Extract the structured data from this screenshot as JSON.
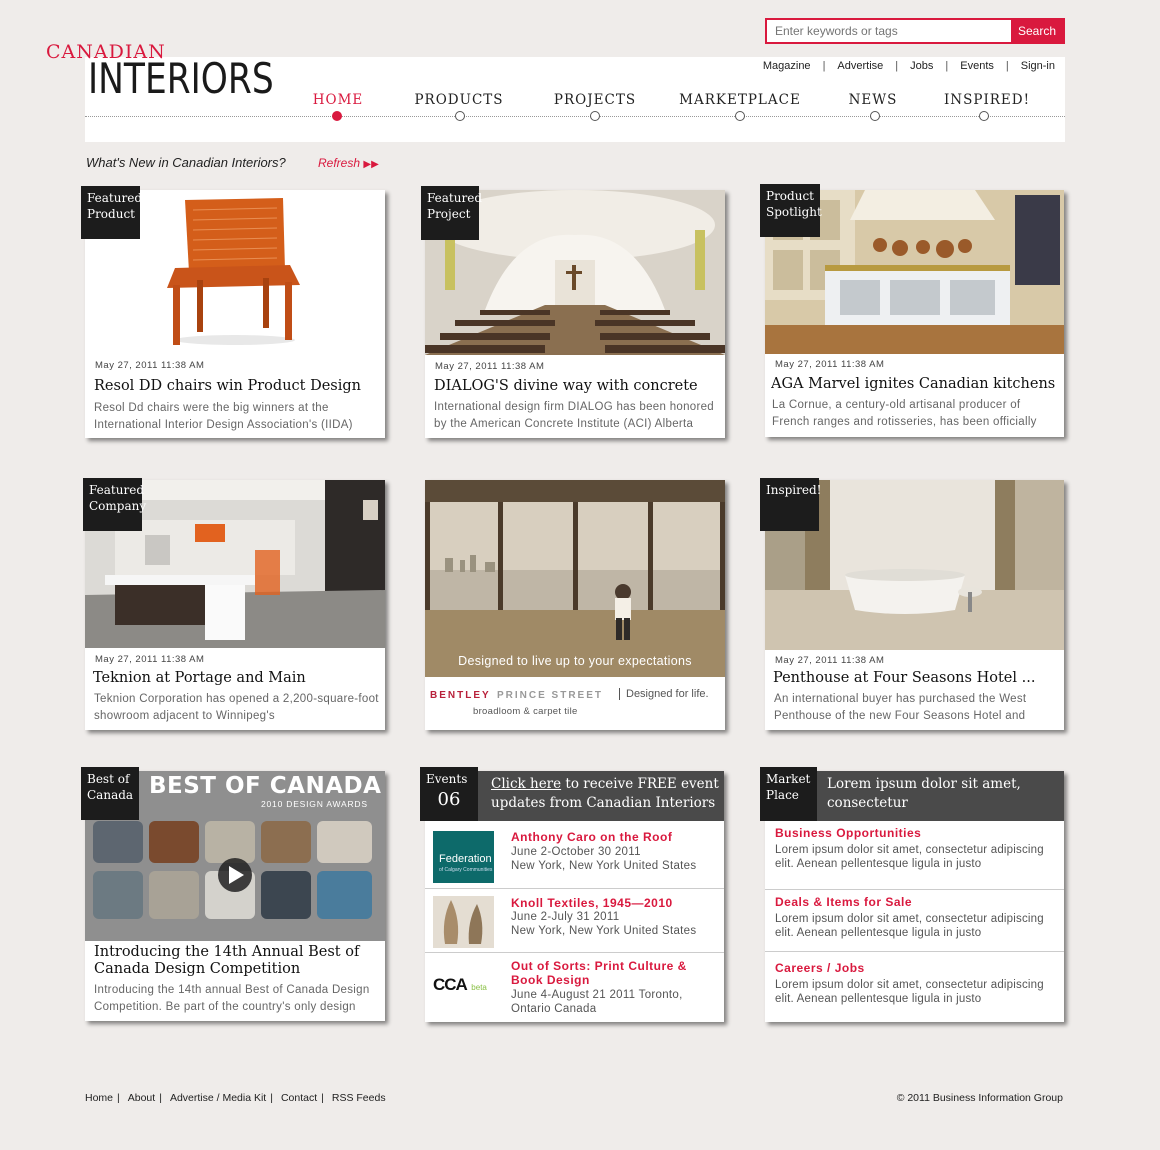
{
  "search": {
    "placeholder": "Enter keywords or tags",
    "button": "Search"
  },
  "logo": {
    "top": "CANADIAN",
    "main": "INTERIORS"
  },
  "util_nav": [
    "Magazine",
    "Advertise",
    "Jobs",
    "Events",
    "Sign-in"
  ],
  "main_nav": [
    "HOME",
    "PRODUCTS",
    "PROJECTS",
    "MARKETPLACE",
    "NEWS",
    "INSPIRED!"
  ],
  "whats_new": {
    "label": "What's New in Canadian Interiors?",
    "refresh": "Refresh"
  },
  "cards": [
    {
      "badge": "Featured Product",
      "date": "May 27, 2011 11:38 AM",
      "title": "Resol DD chairs win Product Design",
      "desc": "Resol Dd chairs were the big winners at the International Interior Design Association's (IIDA)"
    },
    {
      "badge": "Featured Project",
      "date": "May 27, 2011 11:38 AM",
      "title": "DIALOG'S divine way with concrete",
      "desc": "International design firm DIALOG has been honored by the American Concrete Institute (ACI) Alberta"
    },
    {
      "badge": "Product Spotlight",
      "date": "May 27, 2011 11:38 AM",
      "title": "AGA Marvel ignites Canadian kitchens",
      "desc": "La Cornue, a century-old artisanal producer of French ranges and rotisseries, has been officially"
    },
    {
      "badge": "Featured Company",
      "date": "May 27, 2011 11:38 AM",
      "title": "Teknion at Portage and Main",
      "desc": "Teknion Corporation has opened a 2,200-square-foot showroom adjacent to Winnipeg's"
    },
    {
      "badge": "Inspired!",
      "date": "May 27, 2011 11:38 AM",
      "title": "Penthouse at Four Seasons Hotel ...",
      "desc": "An international buyer has purchased the West Penthouse of the new Four Seasons Hotel and"
    },
    {
      "badge": "Best of Canada",
      "title": "Introducing the 14th Annual Best of Canada Design Competition",
      "desc": "Introducing the 14th annual Best of Canada Design Competition. Be part of the country's only design"
    }
  ],
  "ad": {
    "tagline": "Designed to live up to your expectations",
    "brand1": "BENTLEY",
    "brand2": "PRINCE STREET",
    "slogan": "Designed for life.",
    "sub": "broadloom & carpet tile"
  },
  "best_of_canada": {
    "header1": "BEST OF CANADA",
    "header2": "2010 DESIGN AWARDS"
  },
  "events": {
    "label": "Events",
    "count": "06",
    "link": "Click here",
    "promo": "to receive FREE event updates from Canadian Interiors",
    "items": [
      {
        "thumb": "Federation",
        "thumb_sub": "of Calgary Communities",
        "title": "Anthony Caro on the Roof",
        "line1": "June 2-October 30 2011",
        "line2": "New York,  New York  United States"
      },
      {
        "title": "Knoll Textiles, 1945—2010",
        "line1": "June 2-July 31 2011",
        "line2": "New York,  New York  United States"
      },
      {
        "thumb": "CCA",
        "thumb_sub": "beta",
        "title": "Out of Sorts: Print Culture & Book Design",
        "line1": "June 4-August 21 2011  Toronto,",
        "line2": "Ontario  Canada"
      }
    ]
  },
  "marketplace": {
    "label": "Market Place",
    "header": "Lorem ipsum dolor sit amet, consectetur",
    "items": [
      {
        "title": "Business Opportunities",
        "desc": "Lorem ipsum dolor sit amet, consectetur adipiscing elit. Aenean pellentesque ligula in justo"
      },
      {
        "title": "Deals & Items for Sale",
        "desc": "Lorem ipsum dolor sit amet, consectetur adipiscing elit. Aenean pellentesque ligula in justo"
      },
      {
        "title": "Careers / Jobs",
        "desc": "Lorem ipsum dolor sit amet, consectetur adipiscing elit. Aenean pellentesque ligula in justo"
      }
    ]
  },
  "footer": {
    "links": [
      "Home",
      "About",
      "Advertise / Media Kit",
      "Contact",
      "RSS Feeds"
    ],
    "copyright": "© 2011 Business Information Group"
  },
  "colors": {
    "accent": "#d9193e",
    "background": "#efecea",
    "badge": "#1c1c1c",
    "panel_header": "#4a4a4a"
  }
}
